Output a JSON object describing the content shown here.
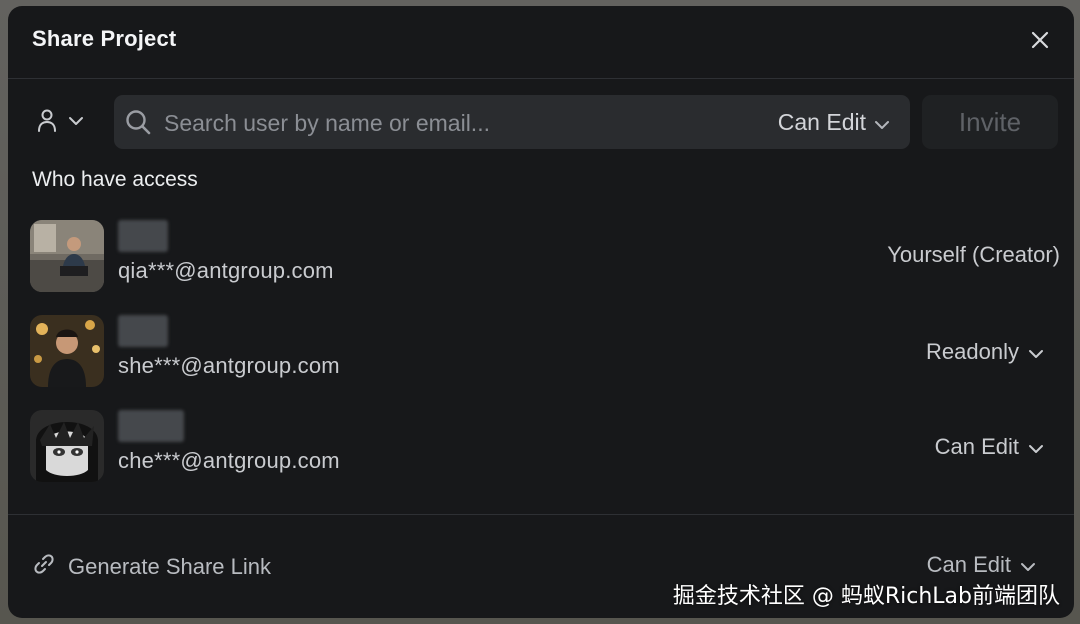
{
  "dialog": {
    "title": "Share Project",
    "close_icon": "close-icon"
  },
  "invite_bar": {
    "role_icon": "user-icon",
    "search_placeholder": "Search user by name or email...",
    "permission_label": "Can Edit",
    "invite_label": "Invite"
  },
  "access": {
    "heading": "Who have access",
    "members": [
      {
        "email": "qia***@antgroup.com",
        "role": "Yourself (Creator)",
        "editable": false
      },
      {
        "email": "she***@antgroup.com",
        "role": "Readonly",
        "editable": true
      },
      {
        "email": "che***@antgroup.com",
        "role": "Can Edit",
        "editable": true
      }
    ]
  },
  "footer": {
    "share_link_label": "Generate Share Link",
    "share_link_icon": "link-icon",
    "link_permission": "Can Edit"
  },
  "watermark": "掘金技术社区 @ 蚂蚁RichLab前端团队",
  "colors": {
    "dialog_bg": "#17181a",
    "input_bg": "#2a2c2f",
    "text_primary": "#e9eaec",
    "text_muted": "#8b8e94"
  }
}
